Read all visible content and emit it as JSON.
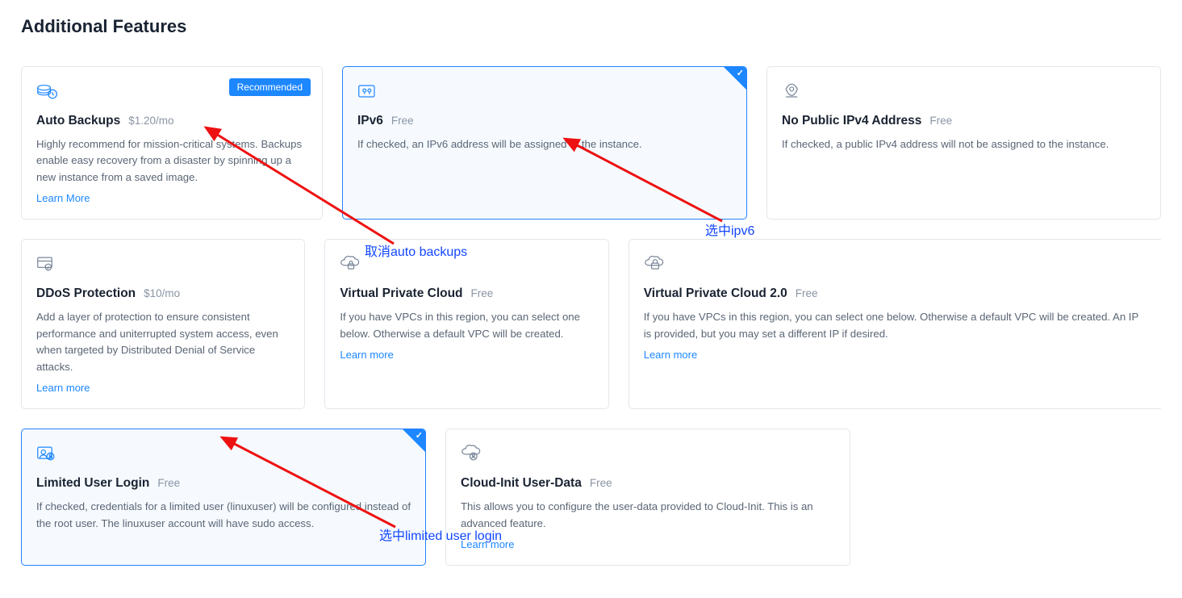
{
  "section_title": "Additional Features",
  "badge_recommended": "Recommended",
  "cards": {
    "auto_backups": {
      "title": "Auto Backups",
      "price": "$1.20/mo",
      "desc": "Highly recommend for mission-critical systems. Backups enable easy recovery from a disaster by spinning up a new instance from a saved image.",
      "link": "Learn More",
      "selected": false,
      "recommended": true
    },
    "ipv6": {
      "title": "IPv6",
      "price": "Free",
      "desc": "If checked, an IPv6 address will be assigned to the instance.",
      "selected": true
    },
    "no_public_ipv4": {
      "title": "No Public IPv4 Address",
      "price": "Free",
      "desc": "If checked, a public IPv4 address will not be assigned to the instance.",
      "selected": false
    },
    "ddos": {
      "title": "DDoS Protection",
      "price": "$10/mo",
      "desc": "Add a layer of protection to ensure consistent performance and uniterrupted system access, even when targeted by Distributed Denial of Service attacks.",
      "link": "Learn more",
      "selected": false
    },
    "vpc": {
      "title": "Virtual Private Cloud",
      "price": "Free",
      "desc": "If you have VPCs in this region, you can select one below. Otherwise a default VPC will be created.",
      "link": "Learn more",
      "selected": false
    },
    "vpc2": {
      "title": "Virtual Private Cloud 2.0",
      "price": "Free",
      "desc": "If you have VPCs in this region, you can select one below. Otherwise a default VPC will be created. An IP is provided, but you may set a different IP if desired.",
      "link": "Learn more",
      "selected": false
    },
    "limited_user": {
      "title": "Limited User Login",
      "price": "Free",
      "desc": "If checked, credentials for a limited user (linuxuser) will be configured instead of the root user. The linuxuser account will have sudo access.",
      "selected": true
    },
    "cloud_init": {
      "title": "Cloud-Init User-Data",
      "price": "Free",
      "desc": "This allows you to configure the user-data provided to Cloud-Init. This is an advanced feature.",
      "link": "Learn more",
      "selected": false
    }
  },
  "annotations": {
    "cancel_auto_backups": "取消auto backups",
    "select_ipv6": "选中ipv6",
    "select_limited_user": "选中limited user login"
  }
}
